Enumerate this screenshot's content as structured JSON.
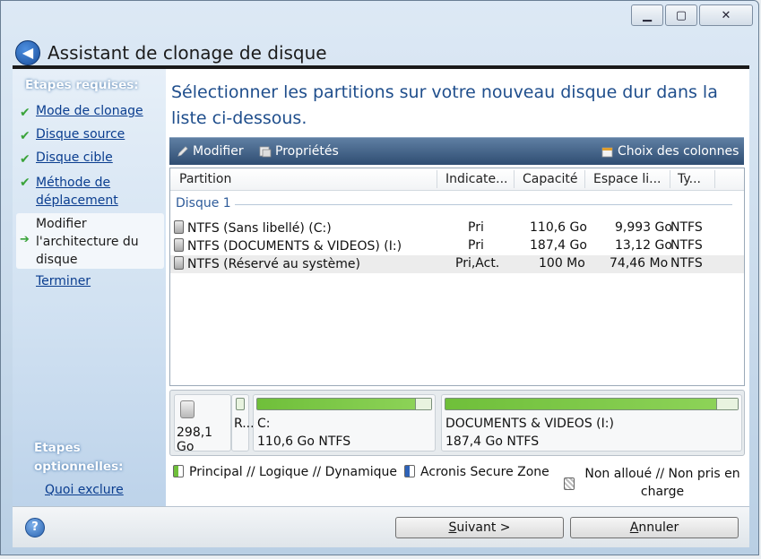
{
  "window": {
    "title": "Assistant de clonage de disque"
  },
  "sidebar": {
    "required_header": "Etapes requises:",
    "steps": [
      {
        "label": "Mode de clonage",
        "done": true
      },
      {
        "label": "Disque source",
        "done": true
      },
      {
        "label": "Disque cible",
        "done": true
      },
      {
        "label": "Méthode de déplacement",
        "done": true
      }
    ],
    "current_step": "Modifier l'architecture du disque",
    "finish": "Terminer",
    "optional_header": "Etapes optionnelles:",
    "optional_link": "Quoi exclure"
  },
  "main": {
    "heading": "Sélectionner les partitions sur votre nouveau disque dur dans la liste ci-dessous.",
    "toolbar": {
      "modify": "Modifier",
      "properties": "Propriétés",
      "columns": "Choix des colonnes"
    },
    "columns": [
      "Partition",
      "Indicate...",
      "Capacité",
      "Espace li...",
      "Ty..."
    ],
    "group": "Disque 1",
    "rows": [
      {
        "partition": "NTFS (Sans libellé) (C:)",
        "flags": "Pri",
        "capacity": "110,6 Go",
        "free": "9,993 Go",
        "type": "NTFS"
      },
      {
        "partition": "NTFS (DOCUMENTS & VIDEOS) (I:)",
        "flags": "Pri",
        "capacity": "187,4 Go",
        "free": "13,12 Go",
        "type": "NTFS"
      },
      {
        "partition": "NTFS (Réservé au système)",
        "flags": "Pri,Act.",
        "capacity": "100 Mo",
        "free": "74,46 Mo",
        "type": "NTFS"
      }
    ]
  },
  "diskmap": {
    "disk_size": "298,1 Go",
    "reserved_label": "R...",
    "partitions": [
      {
        "name": "C:",
        "info": "110,6 Go  NTFS",
        "used_fraction": 0.91
      },
      {
        "name": "DOCUMENTS & VIDEOS (I:)",
        "info": "187,4 Go  NTFS",
        "used_fraction": 0.93
      }
    ]
  },
  "legend": {
    "primary": "Principal // Logique // Dynamique",
    "secure_zone": "Acronis Secure Zone",
    "unallocated": "Non alloué // Non pris en charge"
  },
  "buttons": {
    "next_u": "S",
    "next_rest": "uivant >",
    "cancel_u": "A",
    "cancel_rest": "nnuler"
  },
  "colors": {
    "accent": "#1f4e8c",
    "used_green": "#6fbf3a",
    "toolbar": "#2f4d72"
  }
}
